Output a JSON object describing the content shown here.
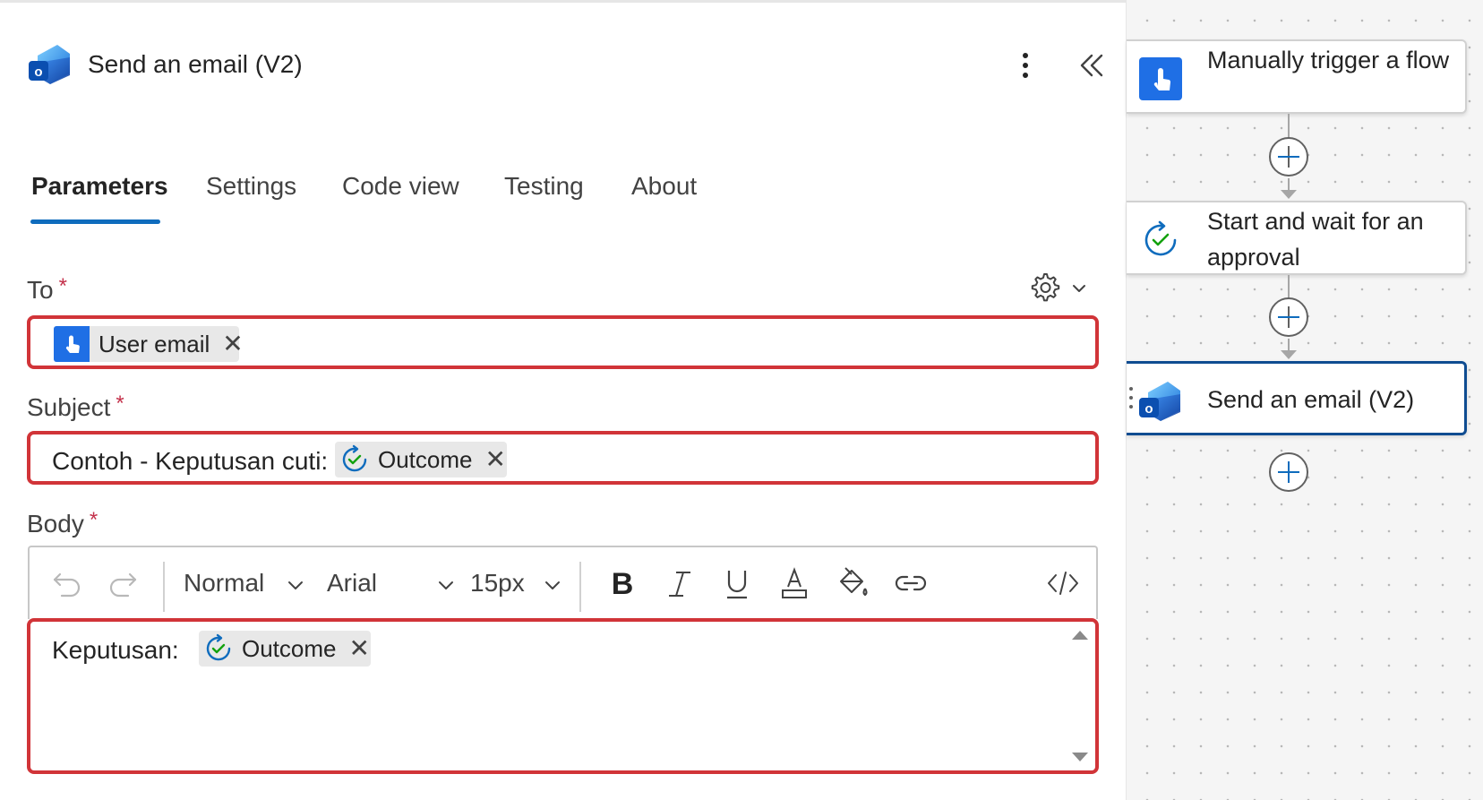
{
  "header": {
    "title": "Send an email (V2)",
    "icon": "outlook-icon"
  },
  "tabs": [
    {
      "label": "Parameters",
      "active": true
    },
    {
      "label": "Settings"
    },
    {
      "label": "Code view"
    },
    {
      "label": "Testing"
    },
    {
      "label": "About"
    }
  ],
  "fields": {
    "to": {
      "label": "To",
      "required_mark": "*",
      "token": {
        "label": "User email",
        "icon": "manual-trigger-icon",
        "remove": "✕"
      }
    },
    "subject": {
      "label": "Subject",
      "required_mark": "*",
      "text": "Contoh - Keputusan cuti:",
      "token": {
        "label": "Outcome",
        "icon": "approval-icon",
        "remove": "✕"
      }
    },
    "body": {
      "label": "Body",
      "required_mark": "*",
      "text": "Keputusan:",
      "token": {
        "label": "Outcome",
        "icon": "approval-icon",
        "remove": "✕"
      }
    }
  },
  "toolbar": {
    "paragraph_style": "Normal",
    "font_family": "Arial",
    "font_size": "15px"
  },
  "flow": {
    "nodes": [
      {
        "label": "Manually trigger a flow",
        "icon": "manual-trigger-icon"
      },
      {
        "label": "Start and wait for an approval",
        "icon": "approval-icon"
      },
      {
        "label": "Send an email (V2)",
        "icon": "outlook-icon",
        "selected": true
      }
    ]
  },
  "colors": {
    "accent": "#0f6cbd",
    "highlight_border": "#d13438",
    "required": "#c4314b",
    "selected_node": "#0f4c91"
  }
}
